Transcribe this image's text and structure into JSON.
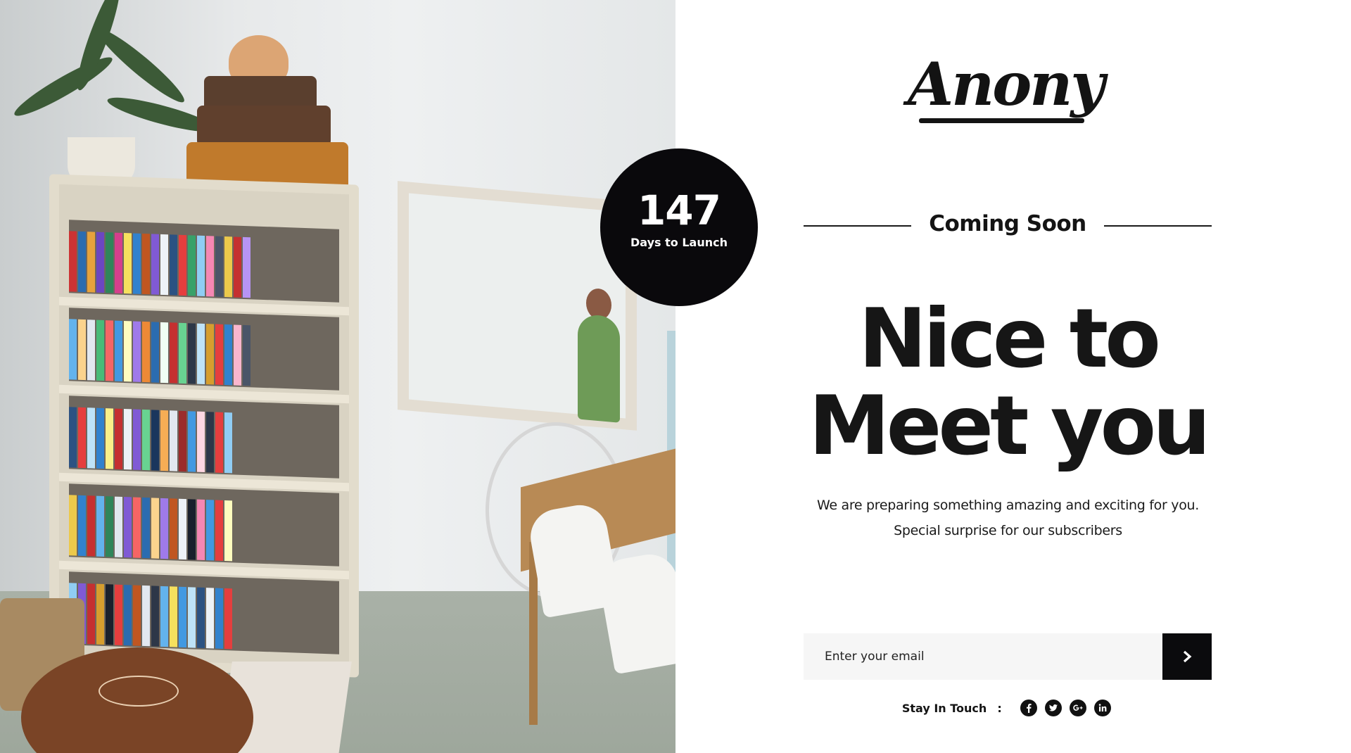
{
  "brand": {
    "logo_text": "Anony"
  },
  "countdown": {
    "value": "147",
    "label": "Days to Launch"
  },
  "section": {
    "kicker": "Coming Soon"
  },
  "hero": {
    "headline_line1": "Nice to",
    "headline_line2": "Meet you",
    "subtext_line1": "We are preparing something amazing and exciting for you.",
    "subtext_line2": "Special surprise for our subscribers"
  },
  "subscribe": {
    "email_placeholder": "Enter your email",
    "submit_icon": "chevron-right-icon"
  },
  "footer": {
    "stay_label": "Stay In Touch",
    "separator": ":",
    "social": [
      {
        "name": "facebook-icon"
      },
      {
        "name": "twitter-icon"
      },
      {
        "name": "google-plus-icon"
      },
      {
        "name": "linkedin-icon"
      }
    ]
  },
  "colors": {
    "accent": "#0b0b0d",
    "text": "#141414",
    "input_bg": "#f6f6f6",
    "background": "#ffffff"
  }
}
